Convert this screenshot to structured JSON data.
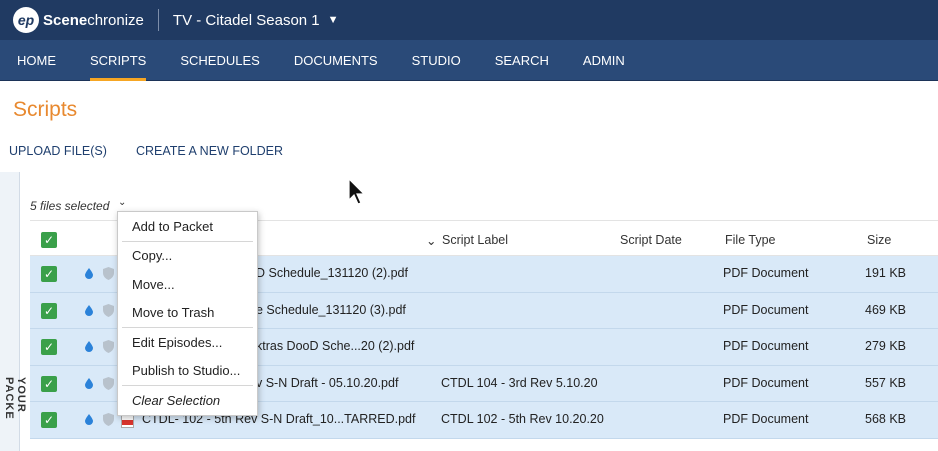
{
  "app": {
    "logo_mark": "ep",
    "logo_bold": "Scene",
    "logo_rest": "chronize",
    "project": "TV - Citadel Season 1"
  },
  "nav": [
    {
      "label": "HOME",
      "active": false
    },
    {
      "label": "SCRIPTS",
      "active": true
    },
    {
      "label": "SCHEDULES",
      "active": false
    },
    {
      "label": "DOCUMENTS",
      "active": false
    },
    {
      "label": "STUDIO",
      "active": false
    },
    {
      "label": "SEARCH",
      "active": false
    },
    {
      "label": "ADMIN",
      "active": false
    }
  ],
  "page": {
    "title": "Scripts",
    "upload_label": "UPLOAD FILE(S)",
    "create_folder_label": "CREATE A NEW FOLDER",
    "selected_count": "5 files selected"
  },
  "side_tab": "YOUR PACKE",
  "table": {
    "headers": {
      "script_label": "Script Label",
      "script_date": "Script Date",
      "file_type": "File Type",
      "size": "Size"
    },
    "rows": [
      {
        "name": "D Schedule_131120 (2).pdf",
        "label": "",
        "date": "",
        "type": "PDF Document",
        "size": "191 KB"
      },
      {
        "name": "e Schedule_131120 (3).pdf",
        "label": "",
        "date": "",
        "type": "PDF Document",
        "size": "469 KB"
      },
      {
        "name": "ktras DooD Sche...20 (2).pdf",
        "label": "",
        "date": "",
        "type": "PDF Document",
        "size": "279 KB"
      },
      {
        "name": "v S-N Draft - 05.10.20.pdf",
        "label": "CTDL 104 - 3rd Rev 5.10.20",
        "date": "",
        "type": "PDF Document",
        "size": "557 KB"
      },
      {
        "name": "CTDL- 102 - 5th Rev S-N Draft_10...TARRED.pdf",
        "label": "CTDL 102 - 5th Rev 10.20.20",
        "date": "",
        "type": "PDF Document",
        "size": "568 KB"
      }
    ]
  },
  "context_menu": {
    "add_to_packet": "Add to Packet",
    "copy": "Copy...",
    "move": "Move...",
    "move_to_trash": "Move to Trash",
    "edit_episodes": "Edit Episodes...",
    "publish_to_studio": "Publish to Studio...",
    "clear_selection": "Clear Selection"
  },
  "colors": {
    "topbar": "#203a62",
    "nav": "#2a4a78",
    "accent": "#f6a623",
    "title": "#e8892f",
    "selection": "#d9e9f8",
    "checkbox": "#3aa04a"
  }
}
